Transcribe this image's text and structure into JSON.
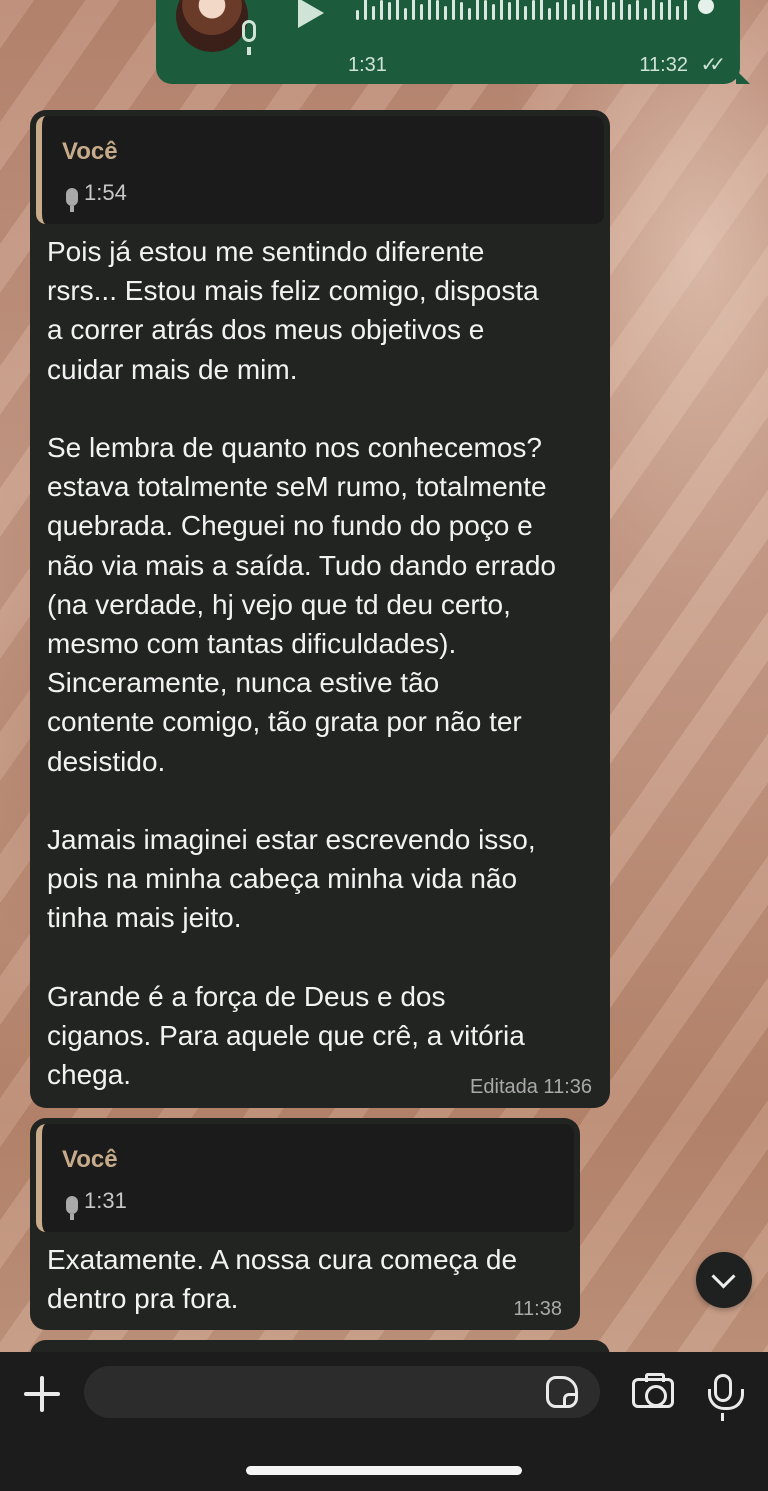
{
  "chat": {
    "sent_voice": {
      "duration": "1:31",
      "time": "11:32",
      "status_ticks": "✓✓"
    },
    "messages": [
      {
        "quote_name": "Você",
        "quote_duration": "1:54",
        "text": "Pois já estou me sentindo diferente\nrsrs... Estou mais feliz comigo, disposta\na correr atrás dos meus objetivos e\ncuidar mais de mim.\n\nSe lembra de quanto nos conhecemos?\nestava totalmente seM rumo, totalmente\nquebrada. Cheguei no fundo do poço e\nnão via mais a saída. Tudo dando errado\n(na verdade, hj vejo que td deu certo,\nmesmo com tantas dificuldades).\nSinceramente, nunca estive tão\ncontente comigo, tão grata por não ter\ndesistido.\n\nJamais imaginei estar escrevendo isso,\npois na minha cabeça minha vida não\ntinha mais jeito.\n\nGrande é a força de Deus e dos\nciganos. Para aquele que crê, a vitória\nchega.",
        "meta": "Editada 11:36"
      },
      {
        "quote_name": "Você",
        "quote_duration": "1:31",
        "text": "Exatamente. A nossa cura começa de\ndentro pra fora.",
        "meta": "11:38"
      }
    ]
  },
  "composer": {
    "input_value": "",
    "input_placeholder": ""
  },
  "icons": {
    "attach": "plus-icon",
    "sticker": "sticker-icon",
    "camera": "camera-icon",
    "mic": "mic-icon",
    "play": "play-icon",
    "scroll_down": "chevron-down-icon"
  },
  "colors": {
    "sent_bubble": "#1c5c3c",
    "received_bubble": "#222422",
    "quote_accent": "#c7ab8a"
  }
}
